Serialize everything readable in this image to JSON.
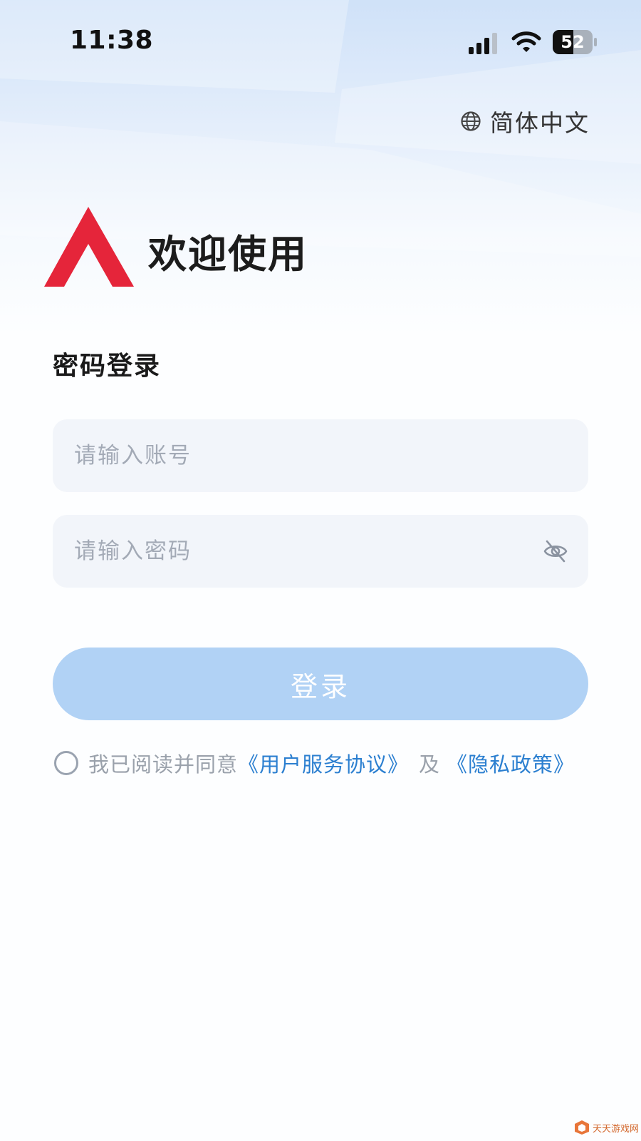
{
  "status_bar": {
    "time": "11:38",
    "battery_level": "52",
    "icons": [
      "signal-icon",
      "wifi-icon",
      "battery-icon"
    ]
  },
  "language": {
    "icon": "globe-icon",
    "label": "简体中文"
  },
  "header": {
    "logo": "brand-logo",
    "brand_color": "#e5253a",
    "welcome": "欢迎使用"
  },
  "login": {
    "title": "密码登录",
    "account_placeholder": "请输入账号",
    "password_placeholder": "请输入密码",
    "password_toggle_icon": "eye-off-icon",
    "submit_label": "登录",
    "submit_color": "#b1d2f5"
  },
  "agreement": {
    "checked": false,
    "text": "我已阅读并同意",
    "terms_link": "《用户服务协议》",
    "and": "及",
    "privacy_link": "《隐私政策》",
    "link_color": "#2b7fd0"
  },
  "watermark": {
    "text": "天天游戏网"
  }
}
